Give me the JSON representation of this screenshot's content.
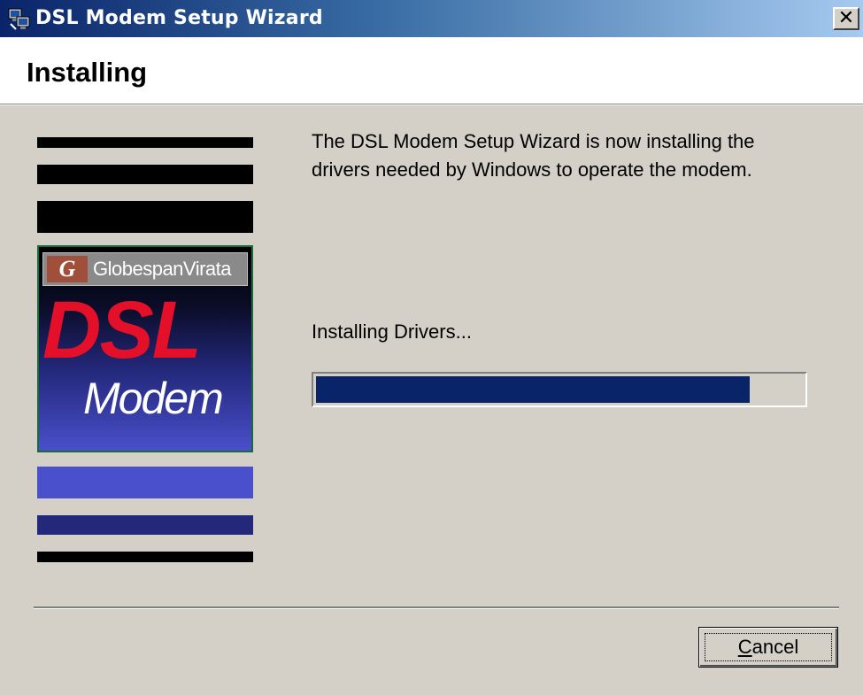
{
  "window": {
    "title": "DSL Modem Setup Wizard",
    "close_label": "✕"
  },
  "header": {
    "title": "Installing"
  },
  "branding": {
    "banner_mark": "G",
    "banner_text": "GlobespanVirata",
    "product_line1": "DSL",
    "product_line2": "Modem"
  },
  "main": {
    "description": "The DSL Modem Setup Wizard is now installing the drivers needed by Windows to operate the modem.",
    "status_text": "Installing Drivers...",
    "progress_fraction": 0.89
  },
  "footer": {
    "cancel_prefix": "",
    "cancel_accel": "C",
    "cancel_rest": "ancel"
  },
  "colors": {
    "progress_fill": "#0a246a",
    "title_bar_start": "#0a246a",
    "dsl_red": "#e4102a"
  },
  "icons": {
    "app": "computer-network-icon",
    "close": "close-icon"
  }
}
